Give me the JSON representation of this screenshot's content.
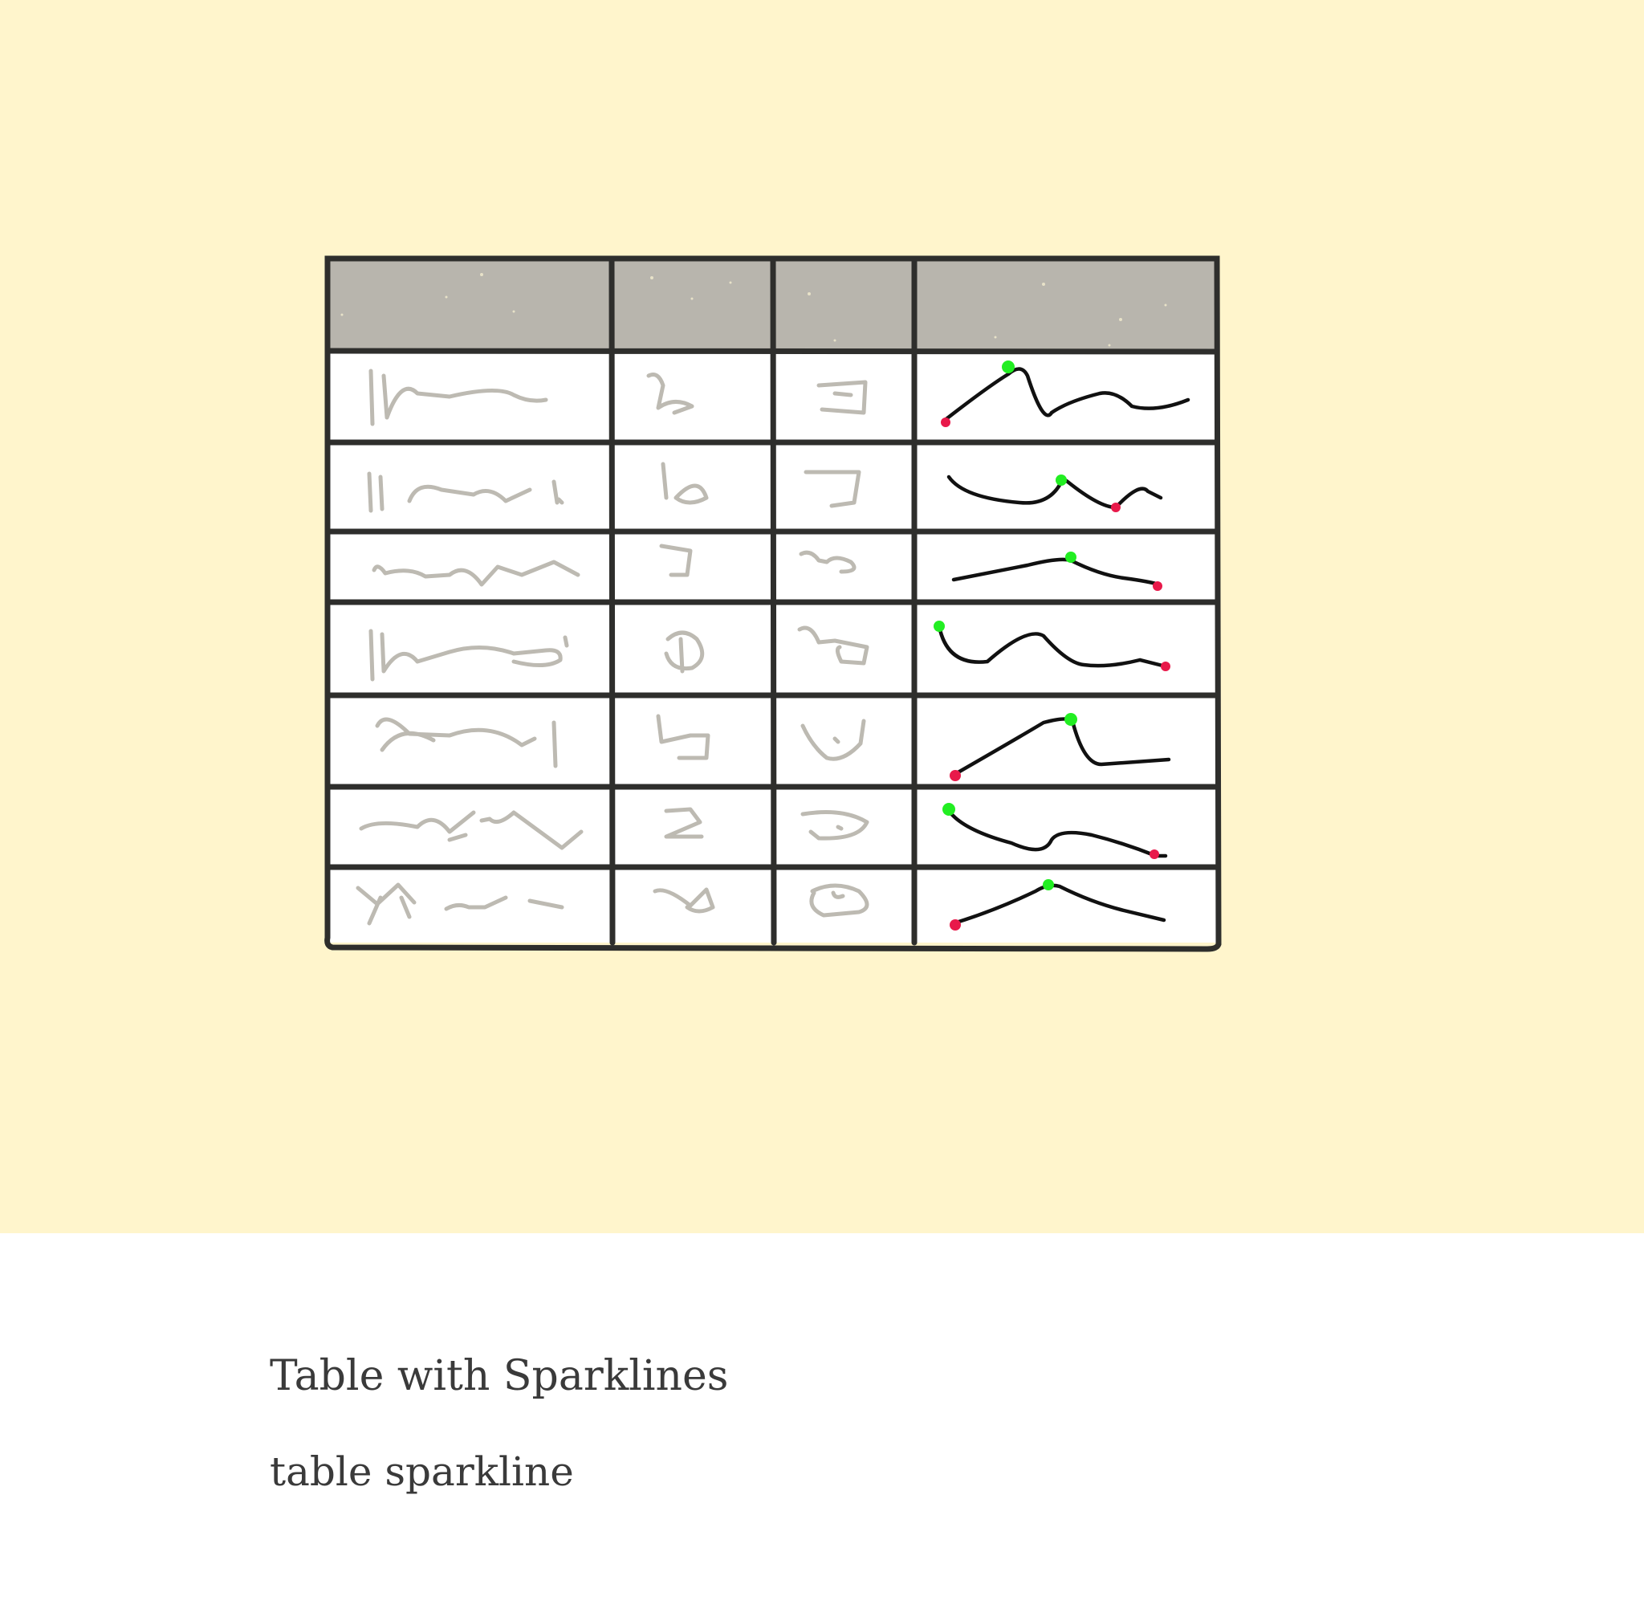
{
  "caption": {
    "title": "Table with Sparklines",
    "tags": "table sparkline"
  },
  "colors": {
    "background_illustration": "#fff5cc",
    "table_border": "#2e2e2c",
    "header_fill": "#b8b5ad",
    "placeholder_scribble": "#bdbab2",
    "sparkline": "#111111",
    "max_marker": "#22ee22",
    "min_marker": "#e8194a"
  },
  "table": {
    "columns": 4,
    "rows": 7,
    "header_filled": true,
    "cell_content": "illegible scribble placeholders",
    "sparkline_column": 4
  }
}
